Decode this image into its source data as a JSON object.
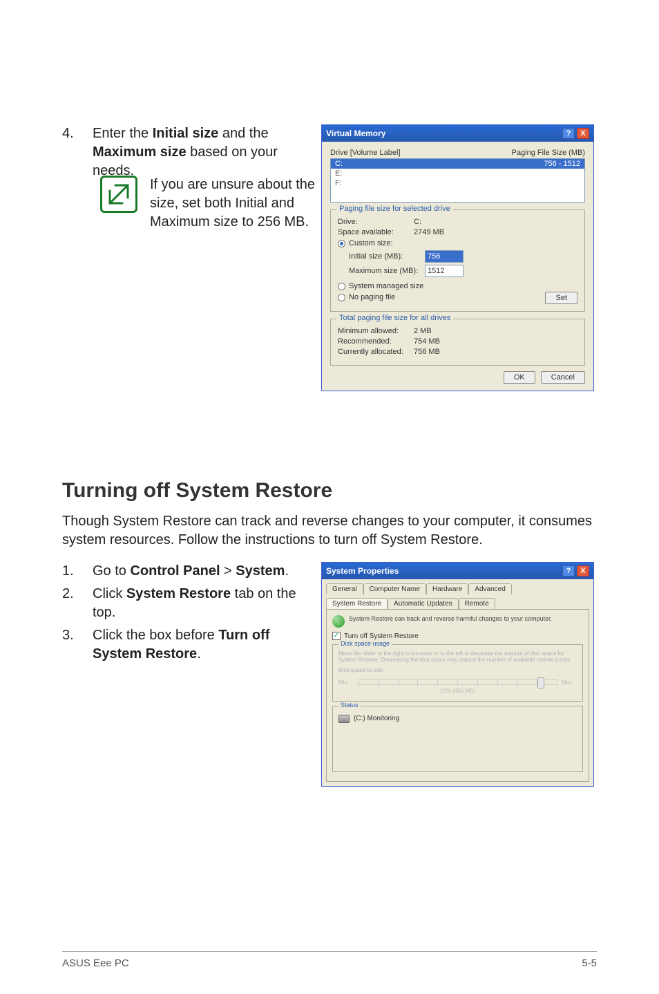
{
  "step4": {
    "num": "4.",
    "text_pre": "Enter the ",
    "bold1": "Initial size",
    "mid": " and the ",
    "bold2": "Maximum size",
    "post": " based on your needs."
  },
  "note": "If you are unsure about the size, set both Initial and Maximum size to 256 MB.",
  "vm_dialog": {
    "title": "Virtual Memory",
    "help": "?",
    "close": "X",
    "col_drive": "Drive  [Volume Label]",
    "col_pf": "Paging File Size (MB)",
    "rows": [
      {
        "d": "C:",
        "v": "756 - 1512",
        "sel": true
      },
      {
        "d": "E:",
        "v": ""
      },
      {
        "d": "F:",
        "v": ""
      }
    ],
    "group1_title": "Paging file size for selected drive",
    "drive_label": "Drive:",
    "drive_val": "C:",
    "space_label": "Space available:",
    "space_val": "2749 MB",
    "r_custom": "Custom size:",
    "init_label": "Initial size (MB):",
    "init_val": "756",
    "max_label": "Maximum size (MB):",
    "max_val": "1512",
    "r_sys": "System managed size",
    "r_none": "No paging file",
    "set_btn": "Set",
    "group2_title": "Total paging file size for all drives",
    "min_label": "Minimum allowed:",
    "min_val": "2 MB",
    "rec_label": "Recommended:",
    "rec_val": "754 MB",
    "cur_label": "Currently allocated:",
    "cur_val": "756 MB",
    "ok": "OK",
    "cancel": "Cancel"
  },
  "heading": "Turning off System Restore",
  "intro": "Though System Restore can track and reverse changes to your computer, it consumes system resources. Follow the instructions to turn off System Restore.",
  "steps2": [
    {
      "num": "1.",
      "pre": "Go to ",
      "b1": "Control Panel",
      "mid": " > ",
      "b2": "System",
      "post": "."
    },
    {
      "num": "2.",
      "pre": "Click ",
      "b1": "System Restore",
      "mid": "",
      "b2": "",
      "post": " tab on the top."
    },
    {
      "num": "3.",
      "pre": "Click the box before ",
      "b1": "Turn off System Restore",
      "mid": "",
      "b2": "",
      "post": "."
    }
  ],
  "sp_dialog": {
    "title": "System Properties",
    "help": "?",
    "close": "X",
    "tabs_row1": [
      "General",
      "Computer Name",
      "Hardware",
      "Advanced"
    ],
    "tabs_row2": [
      "System Restore",
      "Automatic Updates",
      "Remote"
    ],
    "active_tab": "System Restore",
    "desc": "System Restore can track and reverse harmful changes to your computer.",
    "checkbox": "Turn off System Restore",
    "group_disk": "Disk space usage",
    "disk_desc": "Move the slider to the right to increase or to the left to decrease the amount of disk space for System Restore. Decreasing the disk space may reduce the number of available restore points.",
    "disk_space_label": "Disk space to use:",
    "slider_min": "Min",
    "slider_max": "Max",
    "slider_val": "12% (400 MB)",
    "group_status": "Status",
    "status_item": "(C:) Monitoring"
  },
  "footer": {
    "left": "ASUS Eee PC",
    "right": "5-5"
  }
}
